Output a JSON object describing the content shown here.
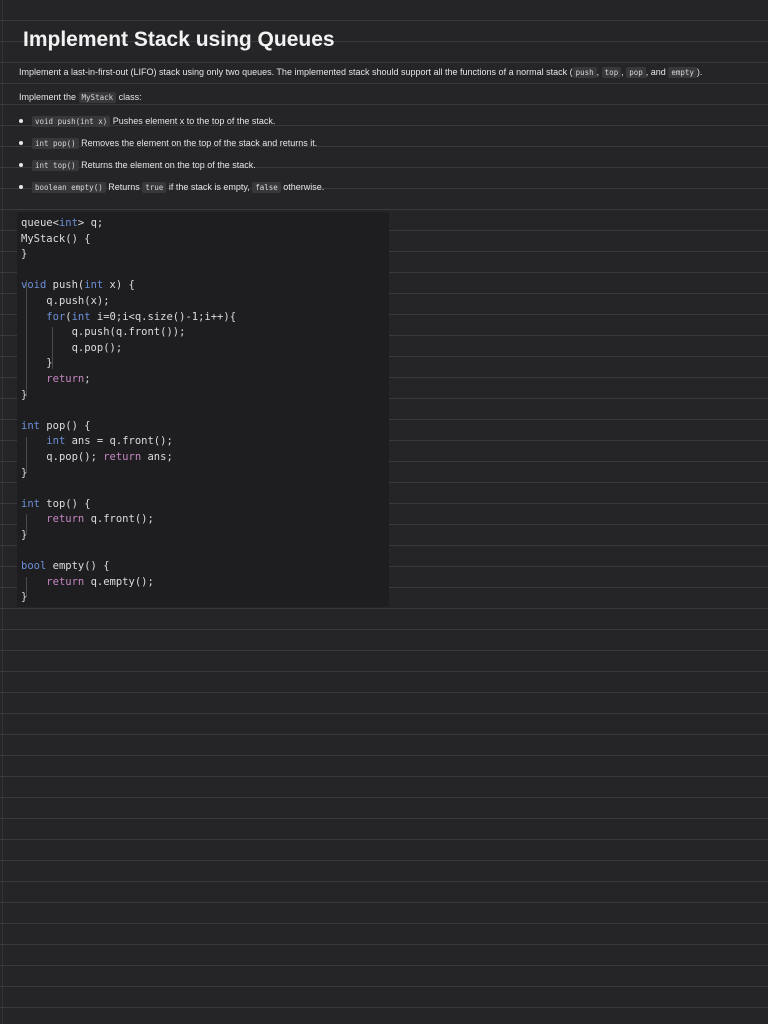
{
  "title": "Implement Stack using Queues",
  "intro": {
    "text_before": "Implement a last-in-first-out (LIFO) stack using only two queues. The implemented stack should support all the functions of a normal stack (",
    "c1": "push",
    "sep1": ", ",
    "c2": "top",
    "sep2": ", ",
    "c3": "pop",
    "sep3": ", and ",
    "c4": "empty",
    "text_after": ")."
  },
  "class_line": {
    "before": "Implement the ",
    "code": "MyStack",
    "after": " class:"
  },
  "methods": [
    {
      "code": "void push(int x)",
      "desc": "Pushes element x to the top of the stack."
    },
    {
      "code": "int pop()",
      "desc": "Removes the element on the top of the stack and returns it."
    },
    {
      "code": "int top()",
      "desc": "Returns the element on the top of the stack."
    },
    {
      "code": "boolean empty()",
      "desc_before": "Returns ",
      "c_true": "true",
      "desc_mid": " if the stack is empty, ",
      "c_false": "false",
      "desc_after": " otherwise."
    }
  ],
  "code_lines": [
    "queue<int> q;",
    "MyStack() {",
    "}",
    "",
    "void push(int x) {",
    "    q.push(x);",
    "    for(int i=0;i<q.size()-1;i++){",
    "        q.push(q.front());",
    "        q.pop();",
    "    }",
    "    return;",
    "}",
    "",
    "int pop() {",
    "    int ans = q.front();",
    "    q.pop(); return ans;",
    "}",
    "",
    "int top() {",
    "    return q.front();",
    "}",
    "",
    "bool empty() {",
    "    return q.empty();",
    "}"
  ]
}
